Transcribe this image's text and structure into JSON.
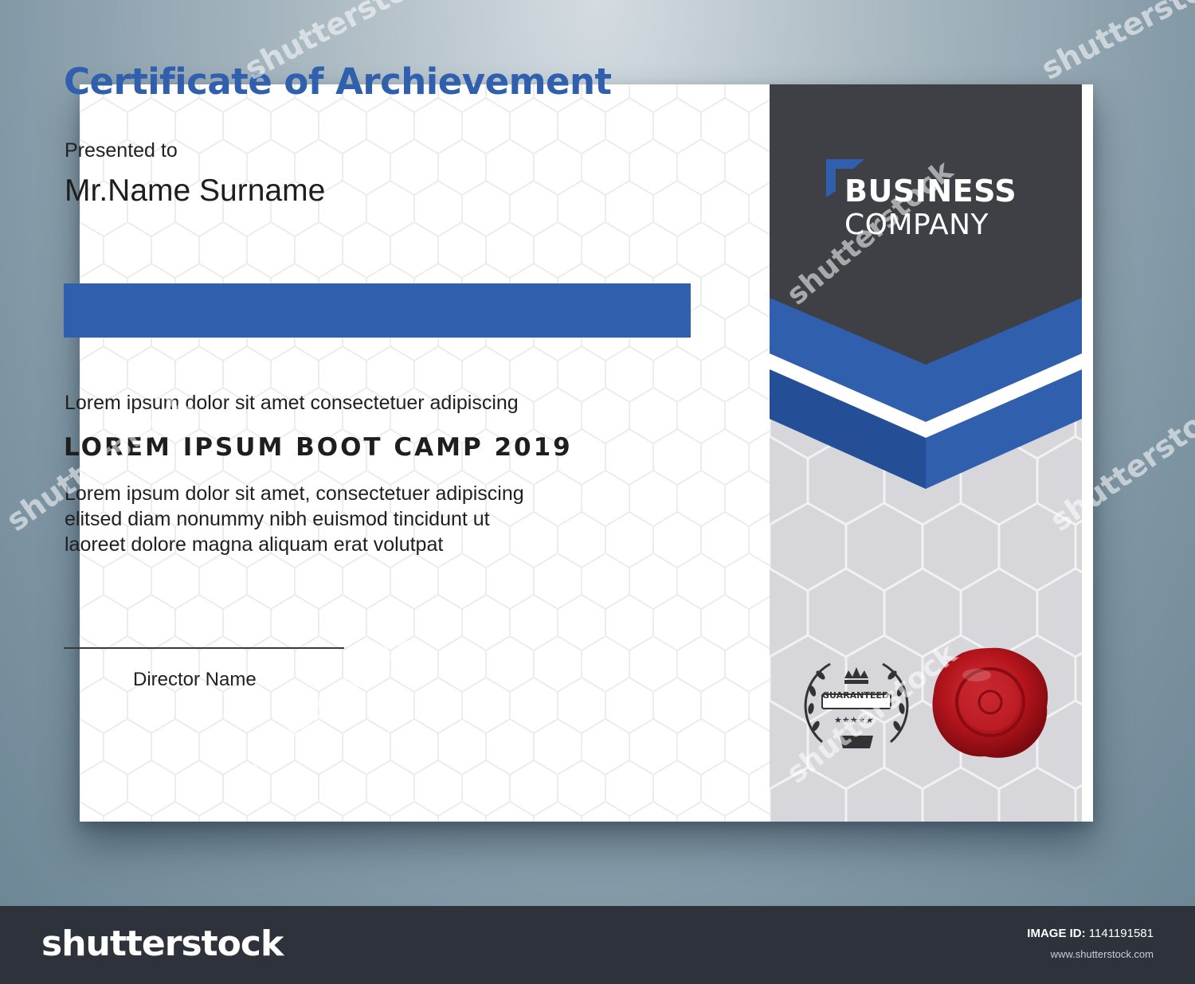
{
  "certificate": {
    "title": "Certificate of Archievement",
    "presented_label": "Presented to",
    "recipient": "Mr.Name Surname",
    "intro": "Lorem ipsum dolor sit amet consectetuer adipiscing",
    "event": "LOREM IPSUM BOOT CAMP 2019",
    "body_lines": [
      "Lorem ipsum dolor sit amet, consectetuer adipiscing",
      "elitsed diam nonummy nibh euismod tincidunt ut",
      "laoreet dolore magna aliquam erat volutpat"
    ],
    "signatory": "Director Name"
  },
  "brand": {
    "line1": "BUSINESS",
    "line2": "COMPANY"
  },
  "badge": {
    "text": "GUARANTEED",
    "stars": 5
  },
  "seal": {
    "icon": "wax-seal-icon"
  },
  "watermark": {
    "text": "shutterstock",
    "footer_logo": "shutterstock",
    "image_id_label": "IMAGE ID:",
    "image_id": "1141191581",
    "url": "www.shutterstock.com"
  },
  "colors": {
    "accent_blue": "#2f5fad",
    "dark_panel": "#3f4045",
    "side_panel": "#d7d6da",
    "seal_red": "#b3141c",
    "footer_bg": "#2e333b"
  }
}
